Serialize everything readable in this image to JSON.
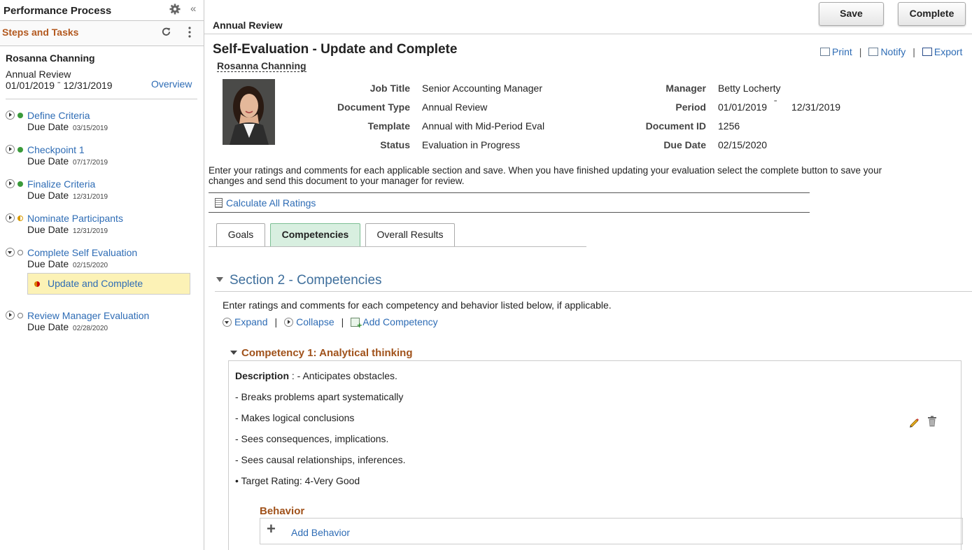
{
  "left": {
    "title": "Performance Process",
    "steps_title": "Steps and Tasks",
    "collapse_glyph": "«",
    "employee_name": "Rosanna Channing",
    "document": "Annual Review",
    "dates": "01/01/2019 ˉ   12/31/2019",
    "overview_link": "Overview",
    "due_label": "Due Date",
    "steps": [
      {
        "label": "Define Criteria",
        "due": "03/15/2019",
        "status": "done"
      },
      {
        "label": "Checkpoint 1",
        "due": "07/17/2019",
        "status": "done"
      },
      {
        "label": "Finalize Criteria",
        "due": "12/31/2019",
        "status": "done"
      },
      {
        "label": "Nominate Participants",
        "due": "12/31/2019",
        "status": "in-progress"
      },
      {
        "label": "Complete Self Evaluation",
        "due": "02/15/2020",
        "status": "not-started"
      },
      {
        "label": "Review Manager Evaluation",
        "due": "02/28/2020",
        "status": "not-started"
      }
    ],
    "substep": "Update and Complete"
  },
  "main": {
    "breadcrumb": "Annual Review",
    "save_label": "Save",
    "complete_label": "Complete",
    "page_title": "Self-Evaluation - Update and Complete",
    "employee_link": "Rosanna Channing",
    "actions": {
      "print": "Print",
      "notify": "Notify",
      "export": "Export"
    },
    "fields": {
      "job_title_label": "Job Title",
      "job_title": "Senior Accounting Manager",
      "doc_type_label": "Document Type",
      "doc_type": "Annual Review",
      "template_label": "Template",
      "template": "Annual with Mid-Period Eval",
      "status_label": "Status",
      "status": "Evaluation in Progress",
      "manager_label": "Manager",
      "manager": "Betty Locherty",
      "period_label": "Period",
      "period_start": "01/01/2019",
      "period_sep": "ˉ",
      "period_end": "12/31/2019",
      "doc_id_label": "Document ID",
      "doc_id": "1256",
      "due_label": "Due Date",
      "due": "02/15/2020"
    },
    "intro": "Enter your ratings and comments for each applicable section and save. When you have finished updating your evaluation select the complete button to save your changes and send this document to your manager for review.",
    "calc_link": "Calculate All Ratings",
    "tabs": [
      {
        "label": "Goals",
        "active": false
      },
      {
        "label": "Competencies",
        "active": true
      },
      {
        "label": "Overall Results",
        "active": false
      }
    ],
    "section_title": "Section 2 - Competencies",
    "section_instr": "Enter ratings and comments for each competency and behavior listed below, if applicable.",
    "tools": {
      "expand": "Expand",
      "collapse": "Collapse",
      "add": "Add Competency"
    },
    "competency": {
      "title": "Competency 1: Analytical thinking",
      "desc_label": "Description",
      "desc_first": " : - Anticipates obstacles.",
      "lines": [
        "- Breaks problems apart systematically",
        "- Makes logical conclusions",
        "- Sees consequences, implications.",
        "- Sees causal relationships, inferences."
      ],
      "target": "Target Rating: 4-Very Good",
      "behavior_title": "Behavior",
      "add_behavior": "Add Behavior"
    },
    "colors": {
      "link": "#2e6cb5",
      "accent": "#b3591f",
      "active_tab": "#d8efe0",
      "section": "#3f6f9c"
    }
  }
}
